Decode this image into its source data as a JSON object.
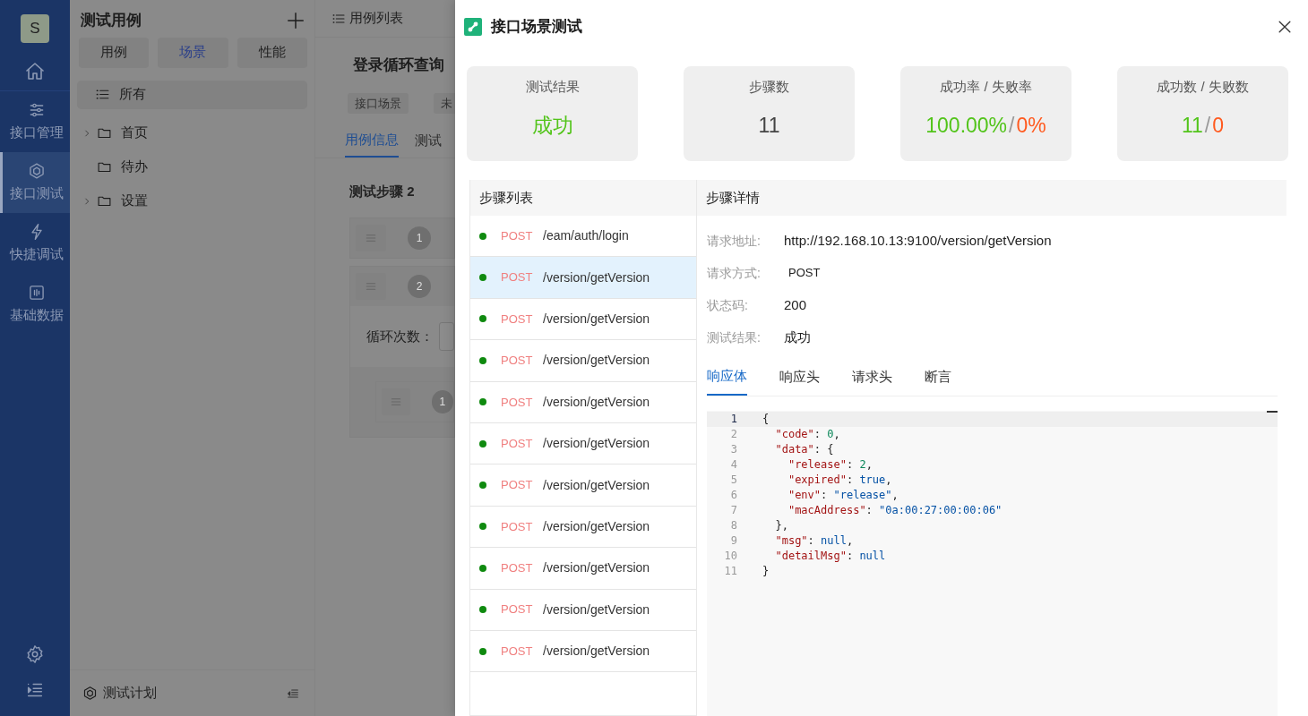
{
  "sidebar": {
    "avatar": "S",
    "items": [
      {
        "label": "接口管理",
        "selected": false
      },
      {
        "label": "接口测试",
        "selected": true
      },
      {
        "label": "快捷调试",
        "selected": false
      },
      {
        "label": "基础数据",
        "selected": false
      }
    ]
  },
  "panel": {
    "title": "测试用例",
    "segments": [
      {
        "label": "用例",
        "selected": false
      },
      {
        "label": "场景",
        "selected": true
      },
      {
        "label": "性能",
        "selected": false
      }
    ],
    "tree": [
      {
        "label": "所有",
        "kind": "list",
        "selected": true
      },
      {
        "label": "首页",
        "kind": "folder",
        "selected": false,
        "expandable": true
      },
      {
        "label": "待办",
        "kind": "folder",
        "selected": false,
        "expandable": false
      },
      {
        "label": "设置",
        "kind": "folder",
        "selected": false,
        "expandable": true
      }
    ],
    "footer": "测试计划"
  },
  "case_view": {
    "breadcrumb": "用例列表",
    "title": "登录循环查询",
    "tags": [
      "接口场景",
      "未"
    ],
    "tabs": [
      {
        "label": "用例信息",
        "selected": true
      },
      {
        "label": "测试",
        "selected": false
      }
    ],
    "steps_title": "测试步骤 2",
    "steps": [
      {
        "number": "1"
      },
      {
        "number": "2",
        "loop_label": "循环次数：",
        "children": [
          {
            "number": "1"
          }
        ]
      }
    ]
  },
  "drawer": {
    "title": "接口场景测试",
    "stats": [
      {
        "label": "测试结果",
        "value": [
          {
            "text": "成功",
            "kind": "success"
          }
        ]
      },
      {
        "label": "步骤数",
        "value": [
          {
            "text": "11",
            "kind": "neutral"
          }
        ]
      },
      {
        "label": "成功率 / 失败率",
        "value": [
          {
            "text": "100.00%",
            "kind": "success"
          },
          {
            "text": "/",
            "kind": "separator"
          },
          {
            "text": "0%",
            "kind": "failure"
          }
        ]
      },
      {
        "label": "成功数 / 失败数",
        "value": [
          {
            "text": "11",
            "kind": "success"
          },
          {
            "text": "/",
            "kind": "separator"
          },
          {
            "text": "0",
            "kind": "failure"
          }
        ]
      }
    ],
    "step_list": {
      "title": "步骤列表",
      "items": [
        {
          "method": "POST",
          "path": "/eam/auth/login",
          "passed": true,
          "selected": false
        },
        {
          "method": "POST",
          "path": "/version/getVersion",
          "passed": true,
          "selected": true
        },
        {
          "method": "POST",
          "path": "/version/getVersion",
          "passed": true,
          "selected": false
        },
        {
          "method": "POST",
          "path": "/version/getVersion",
          "passed": true,
          "selected": false
        },
        {
          "method": "POST",
          "path": "/version/getVersion",
          "passed": true,
          "selected": false
        },
        {
          "method": "POST",
          "path": "/version/getVersion",
          "passed": true,
          "selected": false
        },
        {
          "method": "POST",
          "path": "/version/getVersion",
          "passed": true,
          "selected": false
        },
        {
          "method": "POST",
          "path": "/version/getVersion",
          "passed": true,
          "selected": false
        },
        {
          "method": "POST",
          "path": "/version/getVersion",
          "passed": true,
          "selected": false
        },
        {
          "method": "POST",
          "path": "/version/getVersion",
          "passed": true,
          "selected": false
        },
        {
          "method": "POST",
          "path": "/version/getVersion",
          "passed": true,
          "selected": false
        }
      ]
    },
    "detail": {
      "title": "步骤详情",
      "fields": [
        {
          "label": "请求地址:",
          "value": "http://192.168.10.13:9100/version/getVersion",
          "kind": "text"
        },
        {
          "label": "请求方式:",
          "value": "POST",
          "kind": "method"
        },
        {
          "label": "状态码:",
          "value": "200",
          "kind": "text"
        },
        {
          "label": "测试结果:",
          "value": "成功",
          "kind": "text"
        }
      ],
      "tabs": [
        {
          "label": "响应体",
          "selected": true
        },
        {
          "label": "响应头",
          "selected": false
        },
        {
          "label": "请求头",
          "selected": false
        },
        {
          "label": "断言",
          "selected": false
        }
      ],
      "code_lines": [
        {
          "number": "1",
          "text": "{",
          "active": true
        },
        {
          "number": "2",
          "text": "  \"code\": 0,",
          "active": false
        },
        {
          "number": "3",
          "text": "  \"data\": {",
          "active": false
        },
        {
          "number": "4",
          "text": "    \"release\": 2,",
          "active": false
        },
        {
          "number": "5",
          "text": "    \"expired\": true,",
          "active": false
        },
        {
          "number": "6",
          "text": "    \"env\": \"release\",",
          "active": false
        },
        {
          "number": "7",
          "text": "    \"macAddress\": \"0a:00:27:00:00:06\"",
          "active": false
        },
        {
          "number": "8",
          "text": "  },",
          "active": false
        },
        {
          "number": "9",
          "text": "  \"msg\": null,",
          "active": false
        },
        {
          "number": "10",
          "text": "  \"detailMsg\": null",
          "active": false
        },
        {
          "number": "11",
          "text": "}",
          "active": false
        }
      ]
    }
  }
}
